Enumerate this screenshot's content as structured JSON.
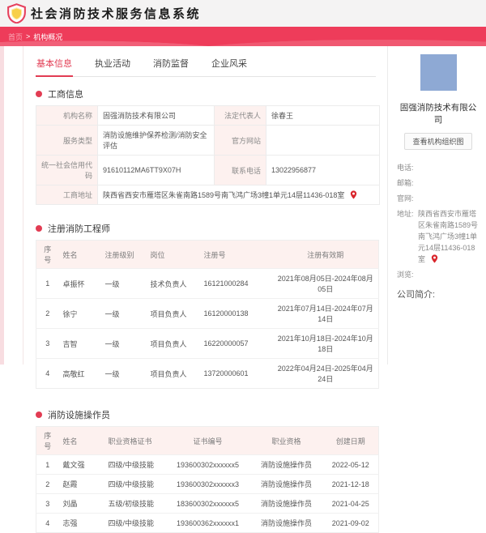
{
  "header": {
    "title": "社会消防技术服务信息系统"
  },
  "breadcrumb": {
    "home": "首页",
    "separator": ">",
    "current": "机构概况"
  },
  "tabs": {
    "items": [
      {
        "label": "基本信息"
      },
      {
        "label": "执业活动"
      },
      {
        "label": "消防监督"
      },
      {
        "label": "企业风采"
      }
    ],
    "active": "基本信息"
  },
  "business": {
    "title": "工商信息",
    "org_name_label": "机构名称",
    "org_name": "固强消防技术有限公司",
    "legal_rep_label": "法定代表人",
    "legal_rep": "徐春王",
    "service_type_label": "服务类型",
    "service_type": "消防设施维护保养检测/消防安全评估",
    "website_label": "官方网站",
    "website": "",
    "credit_code_label": "统一社会信用代码",
    "credit_code": "91610112MA6TT9X07H",
    "phone_label": "联系电话",
    "phone": "13022956877",
    "address_label": "工商地址",
    "address": "陕西省西安市雁塔区朱雀南路1589号南飞鸿广场3幢1单元14层11436-018室"
  },
  "engineers": {
    "title": "注册消防工程师",
    "headers": [
      "序号",
      "姓名",
      "注册级别",
      "岗位",
      "注册号",
      "注册有效期"
    ],
    "rows": [
      [
        "1",
        "卓振怀",
        "一级",
        "技术负责人",
        "16121000284",
        "2021年08月05日-2024年08月05日"
      ],
      [
        "2",
        "徐宁",
        "一级",
        "项目负责人",
        "16120000138",
        "2021年07月14日-2024年07月14日"
      ],
      [
        "3",
        "吉智",
        "一级",
        "项目负责人",
        "16220000057",
        "2021年10月18日-2024年10月18日"
      ],
      [
        "4",
        "高敬红",
        "一级",
        "项目负责人",
        "13720000601",
        "2022年04月24日-2025年04月24日"
      ]
    ]
  },
  "operators": {
    "title": "消防设施操作员",
    "headers": [
      "序号",
      "姓名",
      "职业资格证书",
      "证书编号",
      "职业资格",
      "创建日期"
    ],
    "rows": [
      [
        "1",
        "戴文强",
        "四级/中级技能",
        "193600302xxxxxx5",
        "消防设施操作员",
        "2022-05-12"
      ],
      [
        "2",
        "赵霞",
        "四级/中级技能",
        "193600302xxxxxx3",
        "消防设施操作员",
        "2021-12-18"
      ],
      [
        "3",
        "刘晶",
        "五级/初级技能",
        "183600302xxxxxx5",
        "消防设施操作员",
        "2021-04-25"
      ],
      [
        "4",
        "志强",
        "四级/中级技能",
        "193600362xxxxxx1",
        "消防设施操作员",
        "2021-09-02"
      ]
    ]
  },
  "sidebar": {
    "company_name": "固强消防技术有限公司",
    "org_chart_button": "查看机构组织图",
    "contacts": [
      {
        "label": "电话:",
        "value": ""
      },
      {
        "label": "邮箱:",
        "value": ""
      },
      {
        "label": "官网:",
        "value": ""
      },
      {
        "label": "地址:",
        "value": "陕西省西安市雁塔区朱雀南路1589号南飞鸿广场3幢1单元14层11436-018室"
      },
      {
        "label": "浏览:",
        "value": ""
      }
    ],
    "intro_label": "公司简介:"
  },
  "colors": {
    "accent": "#e23c53",
    "banner": "#ee3c5a",
    "header_bg": "#f4f3f3",
    "table_header_bg": "#fdf1ef",
    "photo_bg": "#8ea9d4"
  }
}
